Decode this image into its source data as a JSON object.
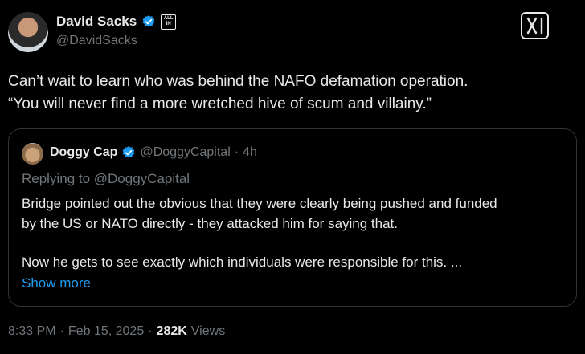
{
  "author": {
    "name": "David Sacks",
    "handle": "@DavidSacks",
    "badge_line1": "ALL",
    "badge_line2": "IN"
  },
  "tweet": {
    "lines": [
      "Can’t wait to learn who was behind the NAFO defamation operation.",
      "“You will never find a more wretched hive of scum and villainy.”"
    ]
  },
  "quote": {
    "name": "Doggy Cap",
    "handle": "@DoggyCapital",
    "separator": "·",
    "time": "4h",
    "replying_to": "Replying to @DoggyCapital",
    "body_lines": [
      "Bridge pointed out the obvious that they were clearly being pushed and funded",
      "by the US or NATO directly - they attacked him for saying that.",
      "Now he gets to see exactly which individuals were responsible for this. ..."
    ],
    "show_more": "Show more"
  },
  "footer": {
    "time": "8:33 PM",
    "sep1": "·",
    "date": "Feb 15, 2025",
    "sep2": "·",
    "views_count": "282K",
    "views_label": "Views"
  },
  "colors": {
    "background": "#000000",
    "text": "#e7e9ea",
    "secondary": "#71767b",
    "link": "#1d9bf0",
    "verified": "#1d9bf0"
  }
}
